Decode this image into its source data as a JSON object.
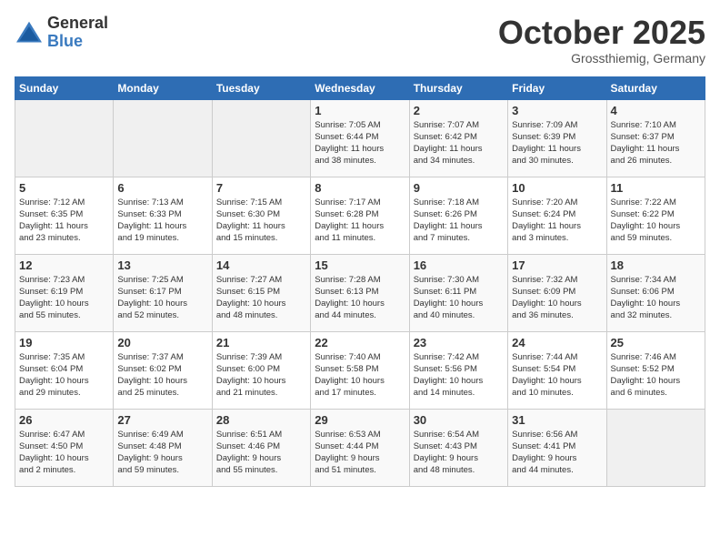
{
  "logo": {
    "general": "General",
    "blue": "Blue"
  },
  "title": "October 2025",
  "subtitle": "Grossthiemig, Germany",
  "days_of_week": [
    "Sunday",
    "Monday",
    "Tuesday",
    "Wednesday",
    "Thursday",
    "Friday",
    "Saturday"
  ],
  "weeks": [
    [
      {
        "day": "",
        "info": ""
      },
      {
        "day": "",
        "info": ""
      },
      {
        "day": "",
        "info": ""
      },
      {
        "day": "1",
        "info": "Sunrise: 7:05 AM\nSunset: 6:44 PM\nDaylight: 11 hours\nand 38 minutes."
      },
      {
        "day": "2",
        "info": "Sunrise: 7:07 AM\nSunset: 6:42 PM\nDaylight: 11 hours\nand 34 minutes."
      },
      {
        "day": "3",
        "info": "Sunrise: 7:09 AM\nSunset: 6:39 PM\nDaylight: 11 hours\nand 30 minutes."
      },
      {
        "day": "4",
        "info": "Sunrise: 7:10 AM\nSunset: 6:37 PM\nDaylight: 11 hours\nand 26 minutes."
      }
    ],
    [
      {
        "day": "5",
        "info": "Sunrise: 7:12 AM\nSunset: 6:35 PM\nDaylight: 11 hours\nand 23 minutes."
      },
      {
        "day": "6",
        "info": "Sunrise: 7:13 AM\nSunset: 6:33 PM\nDaylight: 11 hours\nand 19 minutes."
      },
      {
        "day": "7",
        "info": "Sunrise: 7:15 AM\nSunset: 6:30 PM\nDaylight: 11 hours\nand 15 minutes."
      },
      {
        "day": "8",
        "info": "Sunrise: 7:17 AM\nSunset: 6:28 PM\nDaylight: 11 hours\nand 11 minutes."
      },
      {
        "day": "9",
        "info": "Sunrise: 7:18 AM\nSunset: 6:26 PM\nDaylight: 11 hours\nand 7 minutes."
      },
      {
        "day": "10",
        "info": "Sunrise: 7:20 AM\nSunset: 6:24 PM\nDaylight: 11 hours\nand 3 minutes."
      },
      {
        "day": "11",
        "info": "Sunrise: 7:22 AM\nSunset: 6:22 PM\nDaylight: 10 hours\nand 59 minutes."
      }
    ],
    [
      {
        "day": "12",
        "info": "Sunrise: 7:23 AM\nSunset: 6:19 PM\nDaylight: 10 hours\nand 55 minutes."
      },
      {
        "day": "13",
        "info": "Sunrise: 7:25 AM\nSunset: 6:17 PM\nDaylight: 10 hours\nand 52 minutes."
      },
      {
        "day": "14",
        "info": "Sunrise: 7:27 AM\nSunset: 6:15 PM\nDaylight: 10 hours\nand 48 minutes."
      },
      {
        "day": "15",
        "info": "Sunrise: 7:28 AM\nSunset: 6:13 PM\nDaylight: 10 hours\nand 44 minutes."
      },
      {
        "day": "16",
        "info": "Sunrise: 7:30 AM\nSunset: 6:11 PM\nDaylight: 10 hours\nand 40 minutes."
      },
      {
        "day": "17",
        "info": "Sunrise: 7:32 AM\nSunset: 6:09 PM\nDaylight: 10 hours\nand 36 minutes."
      },
      {
        "day": "18",
        "info": "Sunrise: 7:34 AM\nSunset: 6:06 PM\nDaylight: 10 hours\nand 32 minutes."
      }
    ],
    [
      {
        "day": "19",
        "info": "Sunrise: 7:35 AM\nSunset: 6:04 PM\nDaylight: 10 hours\nand 29 minutes."
      },
      {
        "day": "20",
        "info": "Sunrise: 7:37 AM\nSunset: 6:02 PM\nDaylight: 10 hours\nand 25 minutes."
      },
      {
        "day": "21",
        "info": "Sunrise: 7:39 AM\nSunset: 6:00 PM\nDaylight: 10 hours\nand 21 minutes."
      },
      {
        "day": "22",
        "info": "Sunrise: 7:40 AM\nSunset: 5:58 PM\nDaylight: 10 hours\nand 17 minutes."
      },
      {
        "day": "23",
        "info": "Sunrise: 7:42 AM\nSunset: 5:56 PM\nDaylight: 10 hours\nand 14 minutes."
      },
      {
        "day": "24",
        "info": "Sunrise: 7:44 AM\nSunset: 5:54 PM\nDaylight: 10 hours\nand 10 minutes."
      },
      {
        "day": "25",
        "info": "Sunrise: 7:46 AM\nSunset: 5:52 PM\nDaylight: 10 hours\nand 6 minutes."
      }
    ],
    [
      {
        "day": "26",
        "info": "Sunrise: 6:47 AM\nSunset: 4:50 PM\nDaylight: 10 hours\nand 2 minutes."
      },
      {
        "day": "27",
        "info": "Sunrise: 6:49 AM\nSunset: 4:48 PM\nDaylight: 9 hours\nand 59 minutes."
      },
      {
        "day": "28",
        "info": "Sunrise: 6:51 AM\nSunset: 4:46 PM\nDaylight: 9 hours\nand 55 minutes."
      },
      {
        "day": "29",
        "info": "Sunrise: 6:53 AM\nSunset: 4:44 PM\nDaylight: 9 hours\nand 51 minutes."
      },
      {
        "day": "30",
        "info": "Sunrise: 6:54 AM\nSunset: 4:43 PM\nDaylight: 9 hours\nand 48 minutes."
      },
      {
        "day": "31",
        "info": "Sunrise: 6:56 AM\nSunset: 4:41 PM\nDaylight: 9 hours\nand 44 minutes."
      },
      {
        "day": "",
        "info": ""
      }
    ]
  ]
}
